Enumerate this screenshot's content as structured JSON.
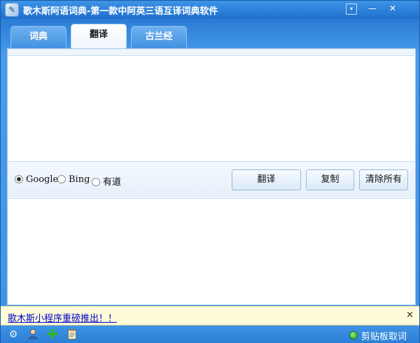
{
  "window": {
    "title": "歌木斯阿语词典-第一款中阿英三语互译词典软件",
    "icon": "dictionary-app-icon",
    "controls": {
      "menu": "▾",
      "minimize": "—",
      "close": "✕"
    }
  },
  "tabs": [
    {
      "label": "词典",
      "active": false
    },
    {
      "label": "翻译",
      "active": true
    },
    {
      "label": "古兰经",
      "active": false
    }
  ],
  "translate": {
    "input_value": "",
    "output_value": "",
    "engines": [
      {
        "label": "Google",
        "selected": true
      },
      {
        "label": "Bing",
        "selected": false
      },
      {
        "label": "有道",
        "selected": false
      }
    ],
    "translate_button": "翻译",
    "copy_button": "复制",
    "clear_button": "清除所有"
  },
  "notice": {
    "link_text": "歌木斯小程序重磅推出！！",
    "close": "✕"
  },
  "statusbar": {
    "icons": [
      "gear-icon",
      "user-icon",
      "add-icon",
      "clipboard-icon"
    ],
    "clipboard_label": "剪贴板取词",
    "clipboard_status_color": "#2a9b1c"
  },
  "colors": {
    "accent": "#2a7fd6",
    "panel": "#eef5fc",
    "notice_bg": "#fffbd8",
    "link": "#0000cc"
  }
}
